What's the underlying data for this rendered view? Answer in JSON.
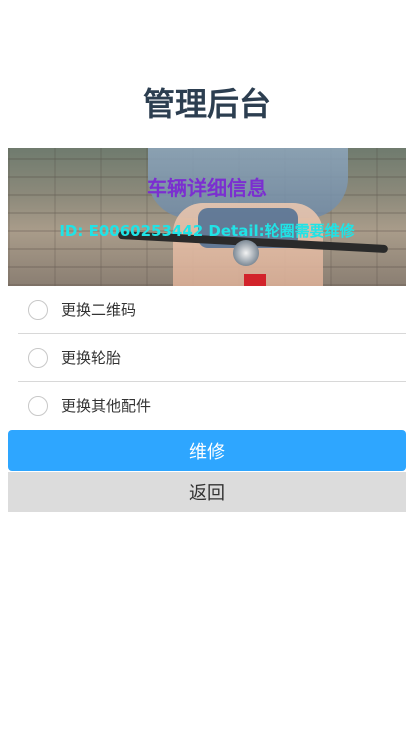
{
  "header": {
    "title": "管理后台"
  },
  "banner": {
    "title": "车辆详细信息",
    "detail": "ID: E0060253442 Detail:轮圈需要维修"
  },
  "options": [
    {
      "label": "更换二维码",
      "selected": false
    },
    {
      "label": "更换轮胎",
      "selected": false
    },
    {
      "label": "更换其他配件",
      "selected": false
    }
  ],
  "actions": {
    "repair_label": "维修",
    "back_label": "返回"
  },
  "colors": {
    "primary": "#2ea6ff",
    "title": "#2c3e50",
    "banner_title": "#7b2fd0",
    "banner_detail": "#20e3e6",
    "secondary_button": "#dcdcdc"
  }
}
